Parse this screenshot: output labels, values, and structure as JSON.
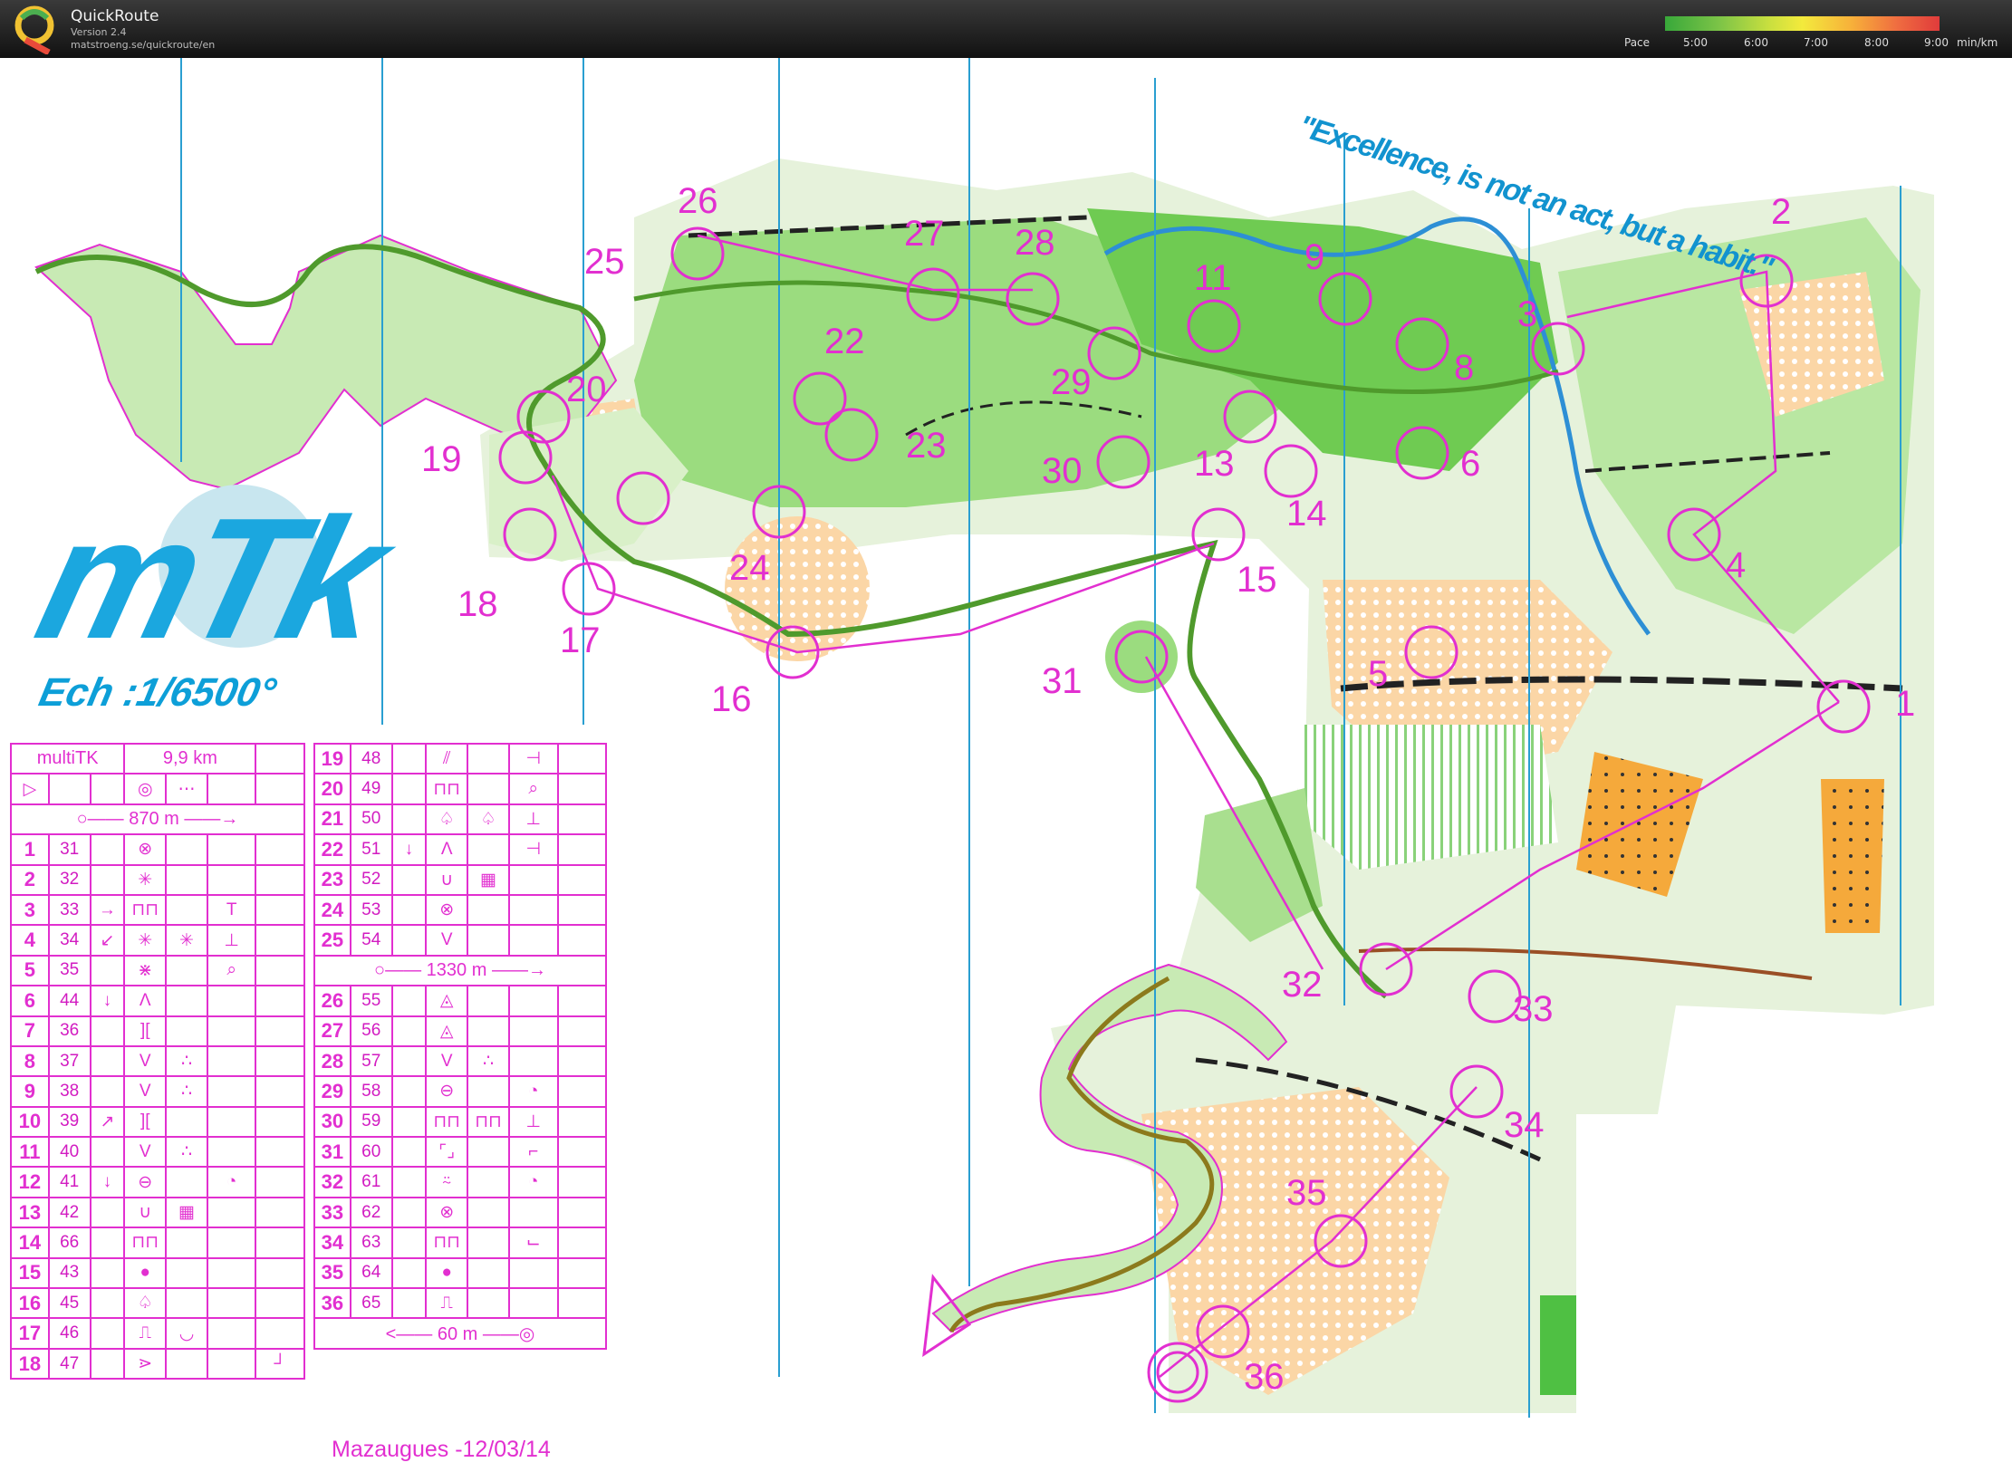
{
  "app": {
    "title": "QuickRoute",
    "version": "Version 2.4",
    "url": "matstroeng.se/quickroute/en"
  },
  "pace": {
    "label": "Pace",
    "ticks": [
      "5:00",
      "6:00",
      "7:00",
      "8:00",
      "9:00"
    ],
    "unit": "min/km",
    "colors": [
      "#38a83a",
      "#c9df3f",
      "#f3ea3c",
      "#f7b03a",
      "#e03b3b"
    ]
  },
  "map": {
    "brand": "mTk",
    "scale": "Ech :1/6500°",
    "quote": "\"Excellence, is not an act, but a habit.\"",
    "footer": "Mazaugues -12/03/14",
    "course_color": "#e22fd0",
    "controls": [
      "1",
      "2",
      "3",
      "4",
      "5",
      "6",
      "8",
      "9",
      "11",
      "13",
      "14",
      "15",
      "16",
      "17",
      "18",
      "19",
      "20",
      "22",
      "23",
      "24",
      "25",
      "26",
      "27",
      "28",
      "29",
      "30",
      "31",
      "32",
      "33",
      "34",
      "35",
      "36"
    ]
  },
  "sheet_left": {
    "course": "multiTK",
    "length": "9,9 km",
    "start_leg": "870 m",
    "rows": [
      {
        "n": "1",
        "code": "31",
        "c": "",
        "d": "⊗",
        "e": "",
        "f": "",
        "g": ""
      },
      {
        "n": "2",
        "code": "32",
        "c": "",
        "d": "✳",
        "e": "",
        "f": "",
        "g": ""
      },
      {
        "n": "3",
        "code": "33",
        "c": "→",
        "d": "⊓⊓",
        "e": "",
        "f": "T",
        "g": ""
      },
      {
        "n": "4",
        "code": "34",
        "c": "↙",
        "d": "✳",
        "e": "✳",
        "f": "⊥",
        "g": ""
      },
      {
        "n": "5",
        "code": "35",
        "c": "",
        "d": "⋇",
        "e": "",
        "f": "⌕",
        "g": ""
      },
      {
        "n": "6",
        "code": "44",
        "c": "↓",
        "d": "Λ",
        "e": "",
        "f": "",
        "g": ""
      },
      {
        "n": "7",
        "code": "36",
        "c": "",
        "d": "][",
        "e": "",
        "f": "",
        "g": ""
      },
      {
        "n": "8",
        "code": "37",
        "c": "",
        "d": "V",
        "e": "∴",
        "f": "",
        "g": ""
      },
      {
        "n": "9",
        "code": "38",
        "c": "",
        "d": "V",
        "e": "∴",
        "f": "",
        "g": ""
      },
      {
        "n": "10",
        "code": "39",
        "c": "↗",
        "d": "][",
        "e": "",
        "f": "",
        "g": ""
      },
      {
        "n": "11",
        "code": "40",
        "c": "",
        "d": "V",
        "e": "∴",
        "f": "",
        "g": ""
      },
      {
        "n": "12",
        "code": "41",
        "c": "↓",
        "d": "⊖",
        "e": "",
        "f": "◔",
        "g": ""
      },
      {
        "n": "13",
        "code": "42",
        "c": "",
        "d": "∪",
        "e": "▦",
        "f": "",
        "g": ""
      },
      {
        "n": "14",
        "code": "66",
        "c": "",
        "d": "⊓⊓",
        "e": "",
        "f": "",
        "g": ""
      },
      {
        "n": "15",
        "code": "43",
        "c": "",
        "d": "●",
        "e": "",
        "f": "",
        "g": ""
      },
      {
        "n": "16",
        "code": "45",
        "c": "",
        "d": "♤",
        "e": "",
        "f": "",
        "g": ""
      },
      {
        "n": "17",
        "code": "46",
        "c": "",
        "d": "⎍",
        "e": "◡",
        "f": "",
        "g": ""
      },
      {
        "n": "18",
        "code": "47",
        "c": "",
        "d": "⋗",
        "e": "",
        "f": "",
        "g": "┘"
      }
    ]
  },
  "sheet_right": {
    "rows_a": [
      {
        "n": "19",
        "code": "48",
        "c": "",
        "d": "⫽",
        "e": "",
        "f": "⊣",
        "g": ""
      },
      {
        "n": "20",
        "code": "49",
        "c": "",
        "d": "⊓⊓",
        "e": "",
        "f": "⌕",
        "g": ""
      },
      {
        "n": "21",
        "code": "50",
        "c": "",
        "d": "♤",
        "e": "♤",
        "f": "⊥",
        "g": ""
      },
      {
        "n": "22",
        "code": "51",
        "c": "↓",
        "d": "Λ",
        "e": "",
        "f": "⊣",
        "g": ""
      },
      {
        "n": "23",
        "code": "52",
        "c": "",
        "d": "∪",
        "e": "▦",
        "f": "",
        "g": ""
      },
      {
        "n": "24",
        "code": "53",
        "c": "",
        "d": "⊗",
        "e": "",
        "f": "",
        "g": ""
      },
      {
        "n": "25",
        "code": "54",
        "c": "",
        "d": "V",
        "e": "",
        "f": "",
        "g": ""
      }
    ],
    "mid_leg": "1330 m",
    "rows_b": [
      {
        "n": "26",
        "code": "55",
        "c": "",
        "d": "◬",
        "e": "",
        "f": "",
        "g": ""
      },
      {
        "n": "27",
        "code": "56",
        "c": "",
        "d": "◬",
        "e": "",
        "f": "",
        "g": ""
      },
      {
        "n": "28",
        "code": "57",
        "c": "",
        "d": "V",
        "e": "∴",
        "f": "",
        "g": ""
      },
      {
        "n": "29",
        "code": "58",
        "c": "",
        "d": "⊖",
        "e": "",
        "f": "◔",
        "g": ""
      },
      {
        "n": "30",
        "code": "59",
        "c": "",
        "d": "⊓⊓",
        "e": "⊓⊓",
        "f": "⊥",
        "g": ""
      },
      {
        "n": "31",
        "code": "60",
        "c": "",
        "d": "⌜⌟",
        "e": "",
        "f": "⌐",
        "g": ""
      },
      {
        "n": "32",
        "code": "61",
        "c": "",
        "d": "⍨",
        "e": "",
        "f": "◔",
        "g": ""
      },
      {
        "n": "33",
        "code": "62",
        "c": "",
        "d": "⊗",
        "e": "",
        "f": "",
        "g": ""
      },
      {
        "n": "34",
        "code": "63",
        "c": "",
        "d": "⊓⊓",
        "e": "",
        "f": "⌙",
        "g": ""
      },
      {
        "n": "35",
        "code": "64",
        "c": "",
        "d": "●",
        "e": "",
        "f": "",
        "g": ""
      },
      {
        "n": "36",
        "code": "65",
        "c": "",
        "d": "⎍",
        "e": "",
        "f": "",
        "g": ""
      }
    ],
    "finish_leg": "60 m"
  }
}
